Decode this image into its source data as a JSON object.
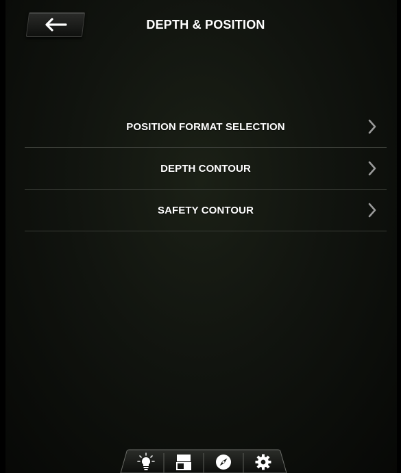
{
  "header": {
    "title": "DEPTH & POSITION",
    "back_icon": "arrow-left-icon"
  },
  "menu": {
    "items": [
      {
        "label": "POSITION FORMAT SELECTION",
        "icon": "chevron-right-icon"
      },
      {
        "label": "DEPTH CONTOUR",
        "icon": "chevron-right-icon"
      },
      {
        "label": "SAFETY CONTOUR",
        "icon": "chevron-right-icon"
      }
    ]
  },
  "tabbar": {
    "tabs": [
      {
        "icon": "lightbulb-icon"
      },
      {
        "icon": "layout-split-icon"
      },
      {
        "icon": "compass-icon"
      },
      {
        "icon": "gear-icon"
      }
    ]
  },
  "colors": {
    "background": "#11140f",
    "text": "#ffffff",
    "divider": "#3a3d37",
    "chevron": "#9a9a9a"
  }
}
